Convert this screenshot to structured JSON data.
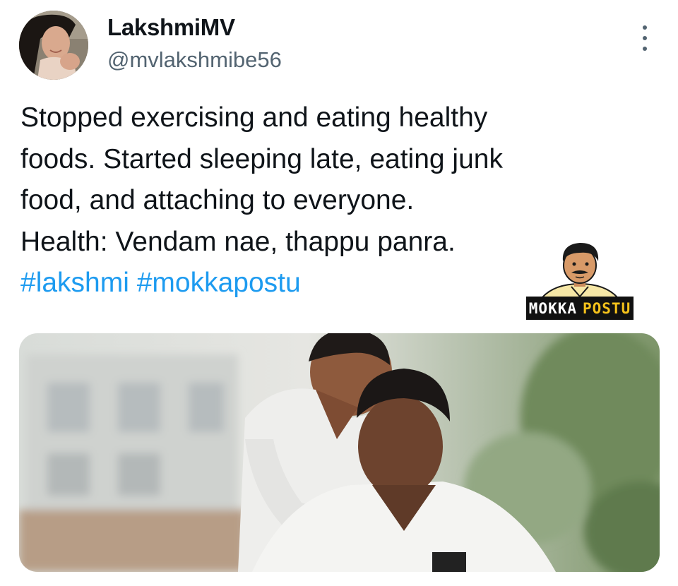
{
  "tweet": {
    "author": {
      "display_name": "LakshmiMV",
      "handle": "@mvlakshmibe56"
    },
    "text_lines": [
      "Stopped exercising and eating healthy",
      "foods. Started sleeping late, eating junk",
      "food, and attaching to everyone.",
      "Health: Vendam nae, thappu panra."
    ],
    "hashtags": [
      "#lakshmi",
      "#mokkapostu"
    ]
  },
  "watermark": {
    "word1": "MOKKA",
    "word2": "POSTU"
  },
  "colors": {
    "text": "#0f1419",
    "secondary": "#536471",
    "link": "#1d9bf0",
    "watermark_accent": "#f5c21b"
  },
  "icons": {
    "more": "vertical-ellipsis-icon"
  }
}
